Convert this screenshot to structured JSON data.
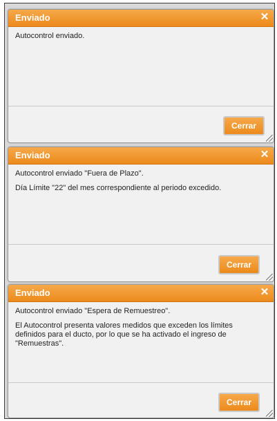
{
  "dialogs": [
    {
      "title": "Enviado",
      "close_glyph": "✕",
      "messages": [
        "Autocontrol enviado."
      ],
      "button": "Cerrar"
    },
    {
      "title": "Enviado",
      "close_glyph": "✕",
      "messages": [
        "Autocontrol enviado \"Fuera de Plazo\".",
        "Día Límite \"22\" del mes correspondiente al periodo excedido."
      ],
      "button": "Cerrar"
    },
    {
      "title": "Enviado",
      "close_glyph": "✕",
      "messages": [
        "Autocontrol enviado \"Espera de Remuestreo\".",
        "El Autocontrol presenta valores medidos que exceden los límites definidos para el ducto, por lo que se ha activado el ingreso de \"Remuestras\"."
      ],
      "button": "Cerrar"
    }
  ],
  "colors": {
    "accent": "#ec8a1c",
    "dialog_bg": "#f1f1f1",
    "overlay_bg": "#d9d9d9"
  },
  "icons": {
    "close": "close-icon",
    "resize": "resize-grip-icon"
  }
}
